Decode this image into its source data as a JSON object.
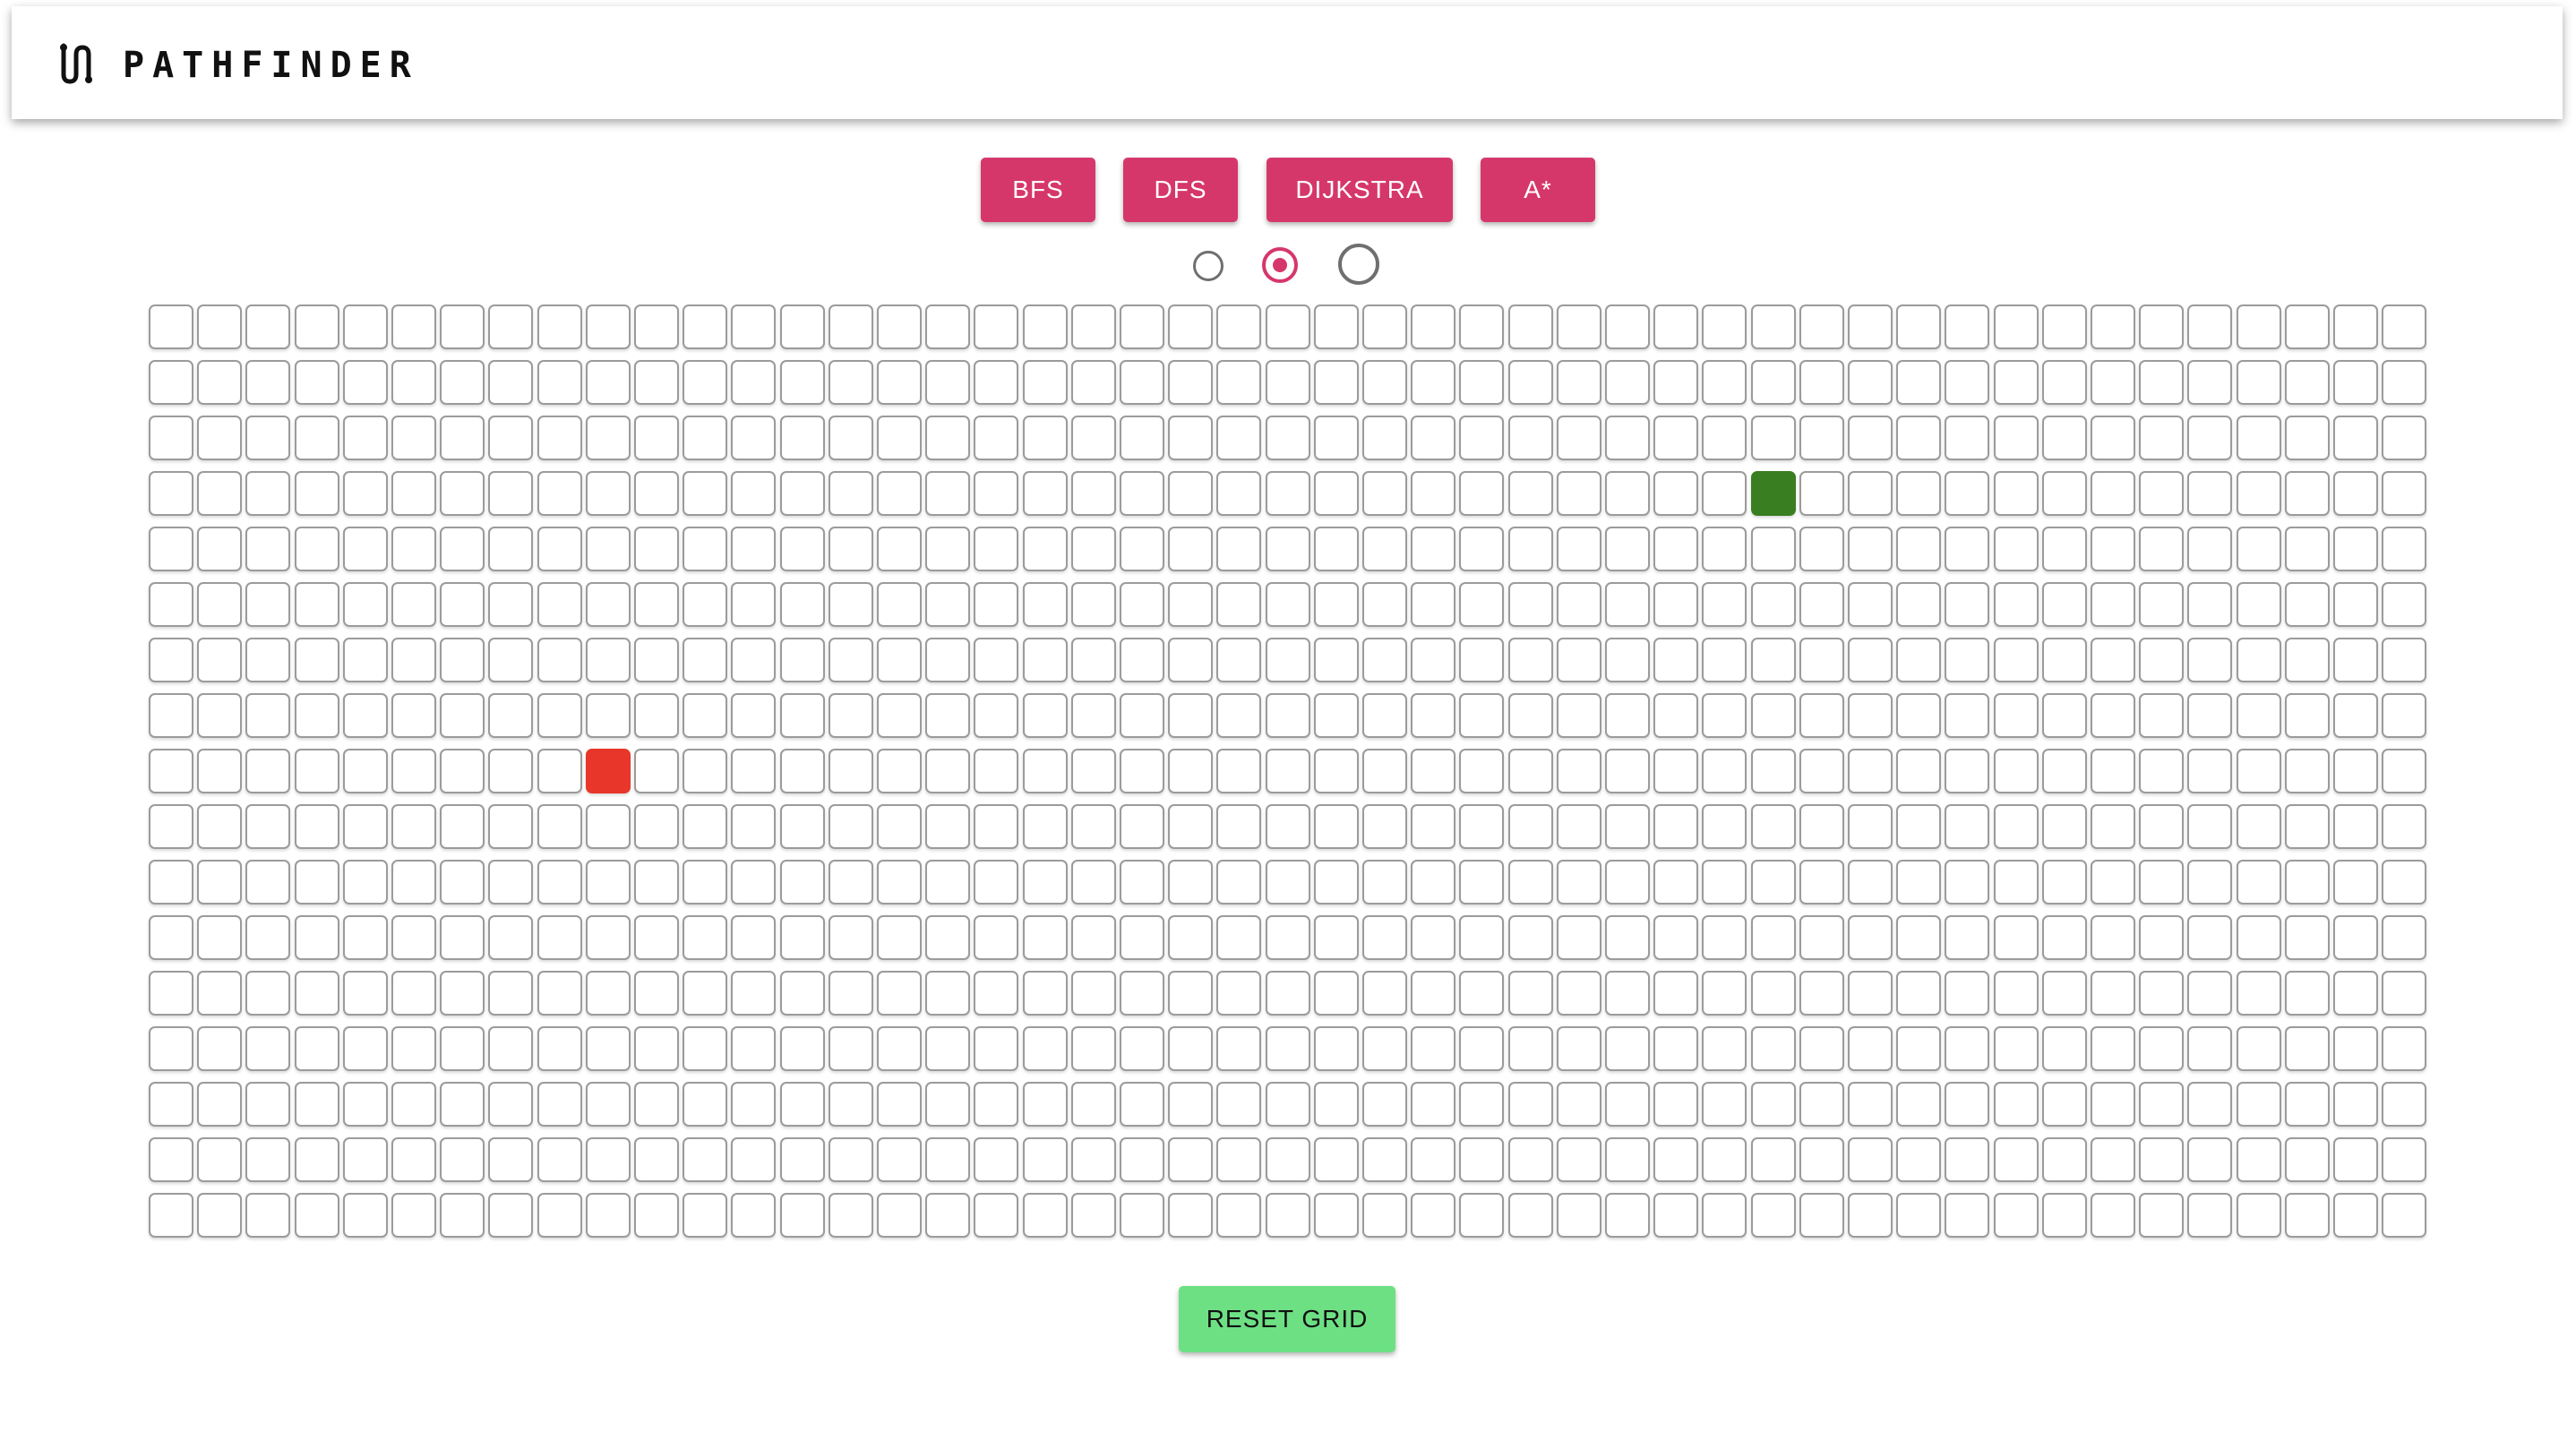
{
  "header": {
    "title": "PATHFINDER",
    "logo_icon": "path-route-icon"
  },
  "algorithms": [
    {
      "label": "BFS"
    },
    {
      "label": "DFS"
    },
    {
      "label": "DIJKSTRA"
    },
    {
      "label": "A*"
    }
  ],
  "node_type_radios": [
    {
      "selected": false
    },
    {
      "selected": true
    },
    {
      "selected": false
    }
  ],
  "grid": {
    "rows": 17,
    "cols": 47,
    "start_cell": {
      "row": 8,
      "col": 9
    },
    "end_cell": {
      "row": 3,
      "col": 33
    }
  },
  "colors": {
    "accent": "#d6376b",
    "start": "#e8362a",
    "end": "#3a7e22",
    "reset": "#6ee084"
  },
  "actions": {
    "reset_label": "RESET GRID"
  }
}
